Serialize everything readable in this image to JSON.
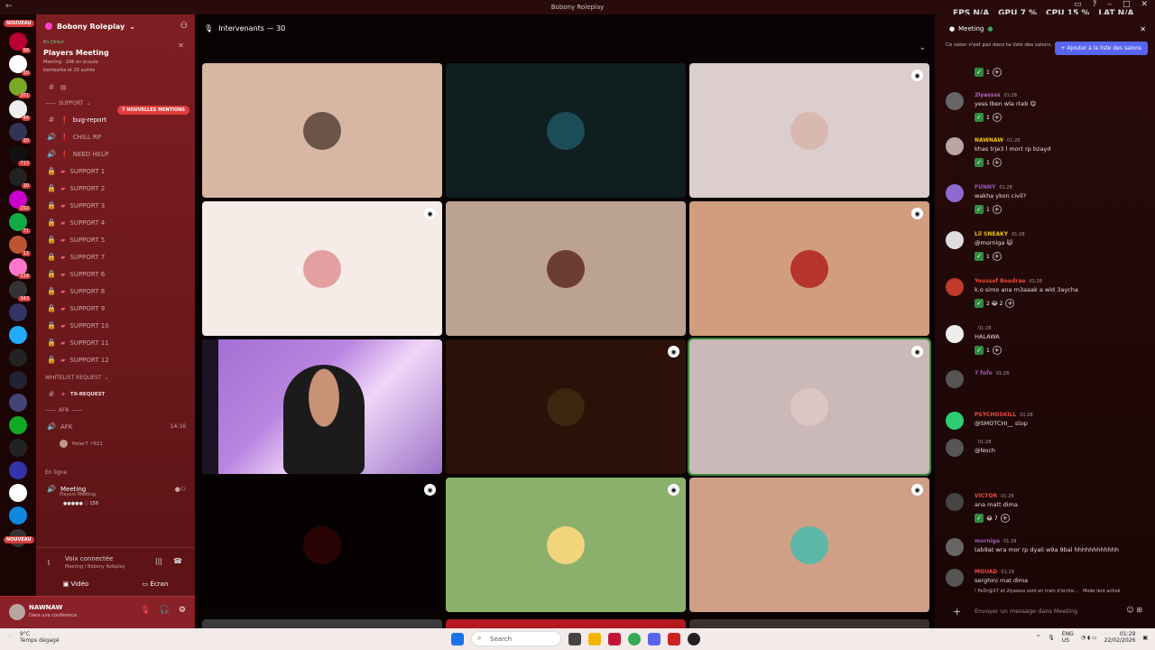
{
  "window": {
    "title": "Bobony Roleplay"
  },
  "perf": {
    "fps_label": "FPS",
    "fps": "N/A",
    "gpu_label": "GPU",
    "gpu": "7 %",
    "cpu_label": "CPU",
    "cpu": "15 %",
    "lat_label": "LAT",
    "lat": "N/A"
  },
  "servers": {
    "badge_new": "NOUVEAU",
    "badges": [
      "58",
      "10",
      "201",
      "49",
      "10",
      "713",
      "10",
      "292",
      "71",
      "13",
      "118",
      "343"
    ]
  },
  "guild": {
    "name": "Bobony Roleplay",
    "event_status": "En Direct",
    "event_title": "Players Meeting",
    "event_meta": "Meeting · 166 en écoute",
    "event_people": "bembarka et 29 autres"
  },
  "channels": {
    "mentions_badge": "7 NOUVELLES MENTIONS",
    "support_cat": "SUPPORT",
    "items": [
      {
        "name": "bug-report",
        "icon": "#",
        "type": "text"
      },
      {
        "name": "CHILL RP",
        "icon": "🔊",
        "type": "voice"
      },
      {
        "name": "NEED HELP",
        "icon": "🔊",
        "type": "voice"
      },
      {
        "name": "SUPPORT 1",
        "icon": "🔒",
        "type": "locked"
      },
      {
        "name": "SUPPORT 2",
        "icon": "🔒",
        "type": "locked"
      },
      {
        "name": "SUPPORT 3",
        "icon": "🔒",
        "type": "locked"
      },
      {
        "name": "SUPPORT 4",
        "icon": "🔒",
        "type": "locked"
      },
      {
        "name": "SUPPORT 5",
        "icon": "🔒",
        "type": "locked"
      },
      {
        "name": "SUPPORT 7",
        "icon": "🔒",
        "type": "locked"
      },
      {
        "name": "SUPPORT 6",
        "icon": "🔒",
        "type": "locked"
      },
      {
        "name": "SUPPORT 8",
        "icon": "🔒",
        "type": "locked"
      },
      {
        "name": "SUPPORT 9",
        "icon": "🔒",
        "type": "locked"
      },
      {
        "name": "SUPPORT 10",
        "icon": "🔒",
        "type": "locked"
      },
      {
        "name": "SUPPORT 11",
        "icon": "🔒",
        "type": "locked"
      },
      {
        "name": "SUPPORT 12",
        "icon": "🔒",
        "type": "locked"
      }
    ],
    "whitelist_cat": "WHITELIST REQUEST",
    "tx_request": "TX-REQUEST",
    "afk_cat": "AFK",
    "afk_channel": "AFK",
    "afk_time": "14:16",
    "afk_user": "Peter7 ⚡921",
    "online_label": "En ligne",
    "meeting_name": "Meeting",
    "meeting_sub": "Players Meeting",
    "meeting_count": "156"
  },
  "voice": {
    "status": "Voix connectée",
    "sub": "Meeting / Bobony Roleplay",
    "video": "Vidéo",
    "screen": "Écran"
  },
  "user": {
    "name": "NAWNAW",
    "status": "Dans une conférence"
  },
  "stage": {
    "header": "Intervenants — 30"
  },
  "tiles": [
    {
      "bg": "#d7b6a3",
      "av": "#6b5448",
      "pin": false
    },
    {
      "bg": "#0f1e1f",
      "av": "#1b4d56",
      "pin": false
    },
    {
      "bg": "#dccdce",
      "av": "#d9b8b0",
      "pin": true
    },
    {
      "bg": "#f7ebe8",
      "av": "#e3a0a0",
      "pin": true
    },
    {
      "bg": "#bca292",
      "av": "#6c3d35",
      "pin": false
    },
    {
      "bg": "#d29c7f",
      "av": "#b5342b",
      "pin": true
    },
    {
      "bg": "webcam",
      "av": "",
      "pin": false
    },
    {
      "bg": "#2b1107",
      "av": "#3e2510",
      "pin": true
    },
    {
      "bg": "#cab9b8",
      "av": "#dcc6c2",
      "pin": true,
      "speaking": true
    },
    {
      "bg": "#060202",
      "av": "#2a0404",
      "pin": true
    },
    {
      "bg": "#8ab06b",
      "av": "#f2d57a",
      "pin": true
    },
    {
      "bg": "#cfa086",
      "av": "#5cb7a6",
      "pin": true
    }
  ],
  "bottom_row": [
    "#3b3b3b",
    "#b3191f",
    "#3a3030"
  ],
  "chat": {
    "channel": "Meeting",
    "notice": "Ce salon n'est pas dans ta liste des salons.",
    "add_button": "+ Ajouter à la liste des salons",
    "messages": [
      {
        "name": "",
        "time": "",
        "text": "",
        "reacts": "1",
        "color": "#aaa",
        "av": "#555"
      },
      {
        "name": "2lyassss",
        "time": "01:28",
        "text": "yess lben wla rteb 😋",
        "reacts": "1",
        "color": "#b068c0",
        "av": "#666"
      },
      {
        "name": "NAWNAW",
        "time": "01:28",
        "text": "khas trje3 l mort rp bzayd",
        "reacts": "1",
        "color": "#f1c40f",
        "av": "#b7a6a2"
      },
      {
        "name": "FUNNY",
        "time": "01:28",
        "text": "wakha ykon civil?",
        "reacts": "1",
        "color": "#9b59b6",
        "av": "#8e6bd1"
      },
      {
        "name": "Lil SNEAKY",
        "time": "01:28",
        "text": "@morniga 😺",
        "reacts": "1",
        "color": "#f1c40f",
        "av": "#ddd"
      },
      {
        "name": "Youssef Boudrae",
        "time": "01:28",
        "text": "k.o simo ana m3aaak a wld 3aycha",
        "reacts": "2 😂 2",
        "color": "#e74c3c",
        "av": "#c0392b"
      },
      {
        "name": "",
        "time": "01:28",
        "text": "HALAWA",
        "reacts": "1",
        "color": "#e74c3c",
        "av": "#eee"
      },
      {
        "name": "7 fofo",
        "time": "01:28",
        "text": "",
        "reacts": "",
        "color": "#9b59b6",
        "av": "#555"
      },
      {
        "name": "PSYCHOSKILL",
        "time": "01:28",
        "text": "@SMOTCHI__ stop",
        "reacts": "",
        "color": "#e74c3c",
        "av": "#2ecc71"
      },
      {
        "name": "",
        "time": "01:28",
        "text": "@Noch",
        "reacts": "",
        "color": "#e74c3c",
        "av": "#555"
      },
      {
        "name": "VICTOR",
        "time": "01:28",
        "text": "ana matt dima",
        "reacts": "😂 7",
        "color": "#e74c3c",
        "av": "#444"
      },
      {
        "name": "morniga",
        "time": "01:29",
        "text": "tab9at wra mor rp dyali w9a 9bal hhhhhhhhhhhh",
        "reacts": "",
        "color": "#9b59b6",
        "av": "#666"
      },
      {
        "name": "MOUAD",
        "time": "01:29",
        "text": "serghini mat dima",
        "reacts": "",
        "color": "#e74c3c",
        "av": "#555"
      }
    ],
    "typing": "! PeDr@X7 et 2lyassss sont en train d'écrire...",
    "slowmode": "Mode lent activé",
    "compose_placeholder": "Envoyer un message dans Meeting"
  },
  "taskbar": {
    "temp": "9°C",
    "weather": "Temps dégagé",
    "search": "Search",
    "lang": "ENG",
    "region": "US",
    "time": "01:29",
    "date": "22/02/2026"
  }
}
